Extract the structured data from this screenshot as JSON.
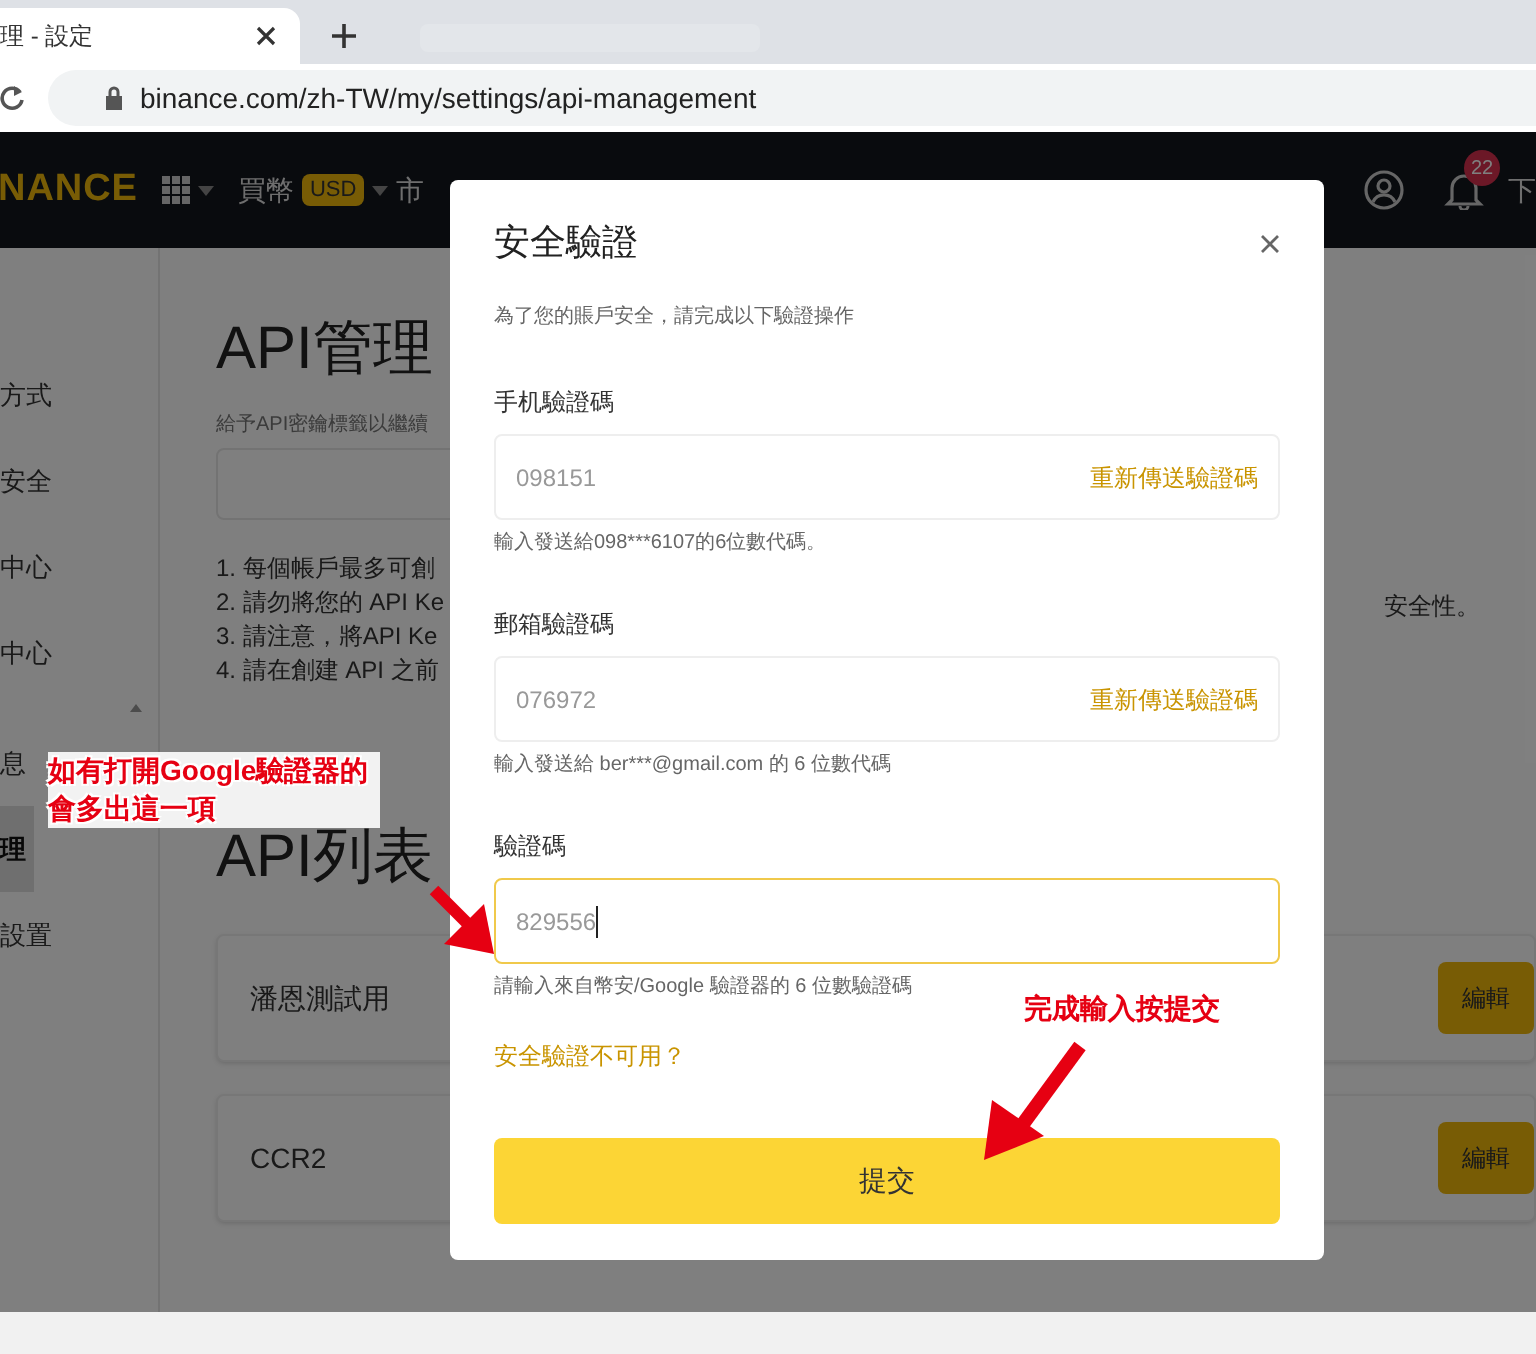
{
  "browser": {
    "tab_title": "理 - 設定",
    "url": "binance.com/zh-TW/my/settings/api-management"
  },
  "nav": {
    "logo": "NANCE",
    "buy": "買幣",
    "currency": "USD",
    "cut_item": "市",
    "notification_count": "22",
    "cut_right": "下"
  },
  "sidebar": {
    "items": [
      {
        "label": "方式",
        "selected": false
      },
      {
        "label": "安全",
        "selected": false
      },
      {
        "label": "中心",
        "selected": false
      },
      {
        "label": "中心",
        "selected": false
      },
      {
        "label": "息",
        "selected": false
      },
      {
        "label": "理",
        "selected": true
      },
      {
        "label": "設置",
        "selected": false
      }
    ]
  },
  "page": {
    "title": "API管理",
    "hint": "給予API密鑰標籤以繼續",
    "notes": [
      "1. 每個帳戶最多可創",
      "2. 請勿將您的 API Ke",
      "3. 請注意，將API Ke",
      "4. 請在創建 API 之前"
    ],
    "note_tail": "安全性。",
    "list_title": "API列表",
    "api_rows": [
      {
        "name": "潘恩測試用",
        "button": "編輯"
      },
      {
        "name": "CCR2",
        "button": "編輯"
      }
    ]
  },
  "dialog": {
    "title": "安全驗證",
    "subtitle": "為了您的賬戶安全，請完成以下驗證操作",
    "fields": [
      {
        "label": "手机驗證碼",
        "value": "098151",
        "action": "重新傳送驗證碼",
        "hint": "輸入發送給098***6107的6位數代碼。",
        "focused": false
      },
      {
        "label": "郵箱驗證碼",
        "value": "076972",
        "action": "重新傳送驗證碼",
        "hint": "輸入發送給 ber***@gmail.com 的 6 位數代碼",
        "focused": false
      },
      {
        "label": "驗證碼",
        "value": "829556",
        "hint": "請輸入來自幣安/Google 驗證器的 6 位數驗證碼",
        "focused": true
      }
    ],
    "unavailable_link": "安全驗證不可用？",
    "submit": "提交"
  },
  "annotations": [
    {
      "text": "如有打開Google驗證器的會多出這一項"
    },
    {
      "text": "完成輸入按提交"
    }
  ]
}
